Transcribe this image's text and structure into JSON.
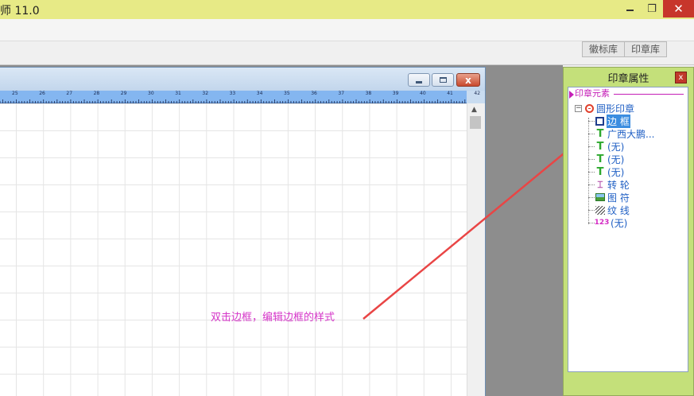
{
  "app": {
    "title": "师 11.0"
  },
  "titlebar": {
    "minimize": "",
    "restore": "❐",
    "close": "✕"
  },
  "library_tabs": [
    {
      "label": "徽标库"
    },
    {
      "label": "印章库"
    }
  ],
  "document": {
    "ruler_labels": [
      "25",
      "26",
      "27",
      "28",
      "29",
      "30",
      "31",
      "32",
      "33",
      "34",
      "35",
      "36",
      "37",
      "38",
      "39",
      "40",
      "41",
      "42"
    ],
    "close": "x"
  },
  "annotation": {
    "text": "双击边框，编辑边框的样式"
  },
  "panel": {
    "title": "印章属性",
    "close": "x",
    "section_label": "印章元素",
    "tree": {
      "root": {
        "label": "圆形印章",
        "expander": "−"
      },
      "children": [
        {
          "icon": "border-icon",
          "label": "边 框",
          "selected": true
        },
        {
          "icon": "text-t1-icon",
          "label": "广西大鹏..."
        },
        {
          "icon": "text-t2-icon",
          "label": "(无)"
        },
        {
          "icon": "text-t3-icon",
          "label": "(无)"
        },
        {
          "icon": "text-t4-icon",
          "label": "(无)"
        },
        {
          "icon": "wheel-icon",
          "label": "转 轮"
        },
        {
          "icon": "picture-icon",
          "label": "图 符"
        },
        {
          "icon": "hatch-icon",
          "label": "纹 线"
        },
        {
          "icon": "number-icon",
          "label": "(无)",
          "icon_text": "123"
        }
      ]
    }
  },
  "colors": {
    "accent": "#e7ea86",
    "panel": "#c4e07a",
    "annotation": "#d535c8",
    "arrow": "#e94545"
  }
}
